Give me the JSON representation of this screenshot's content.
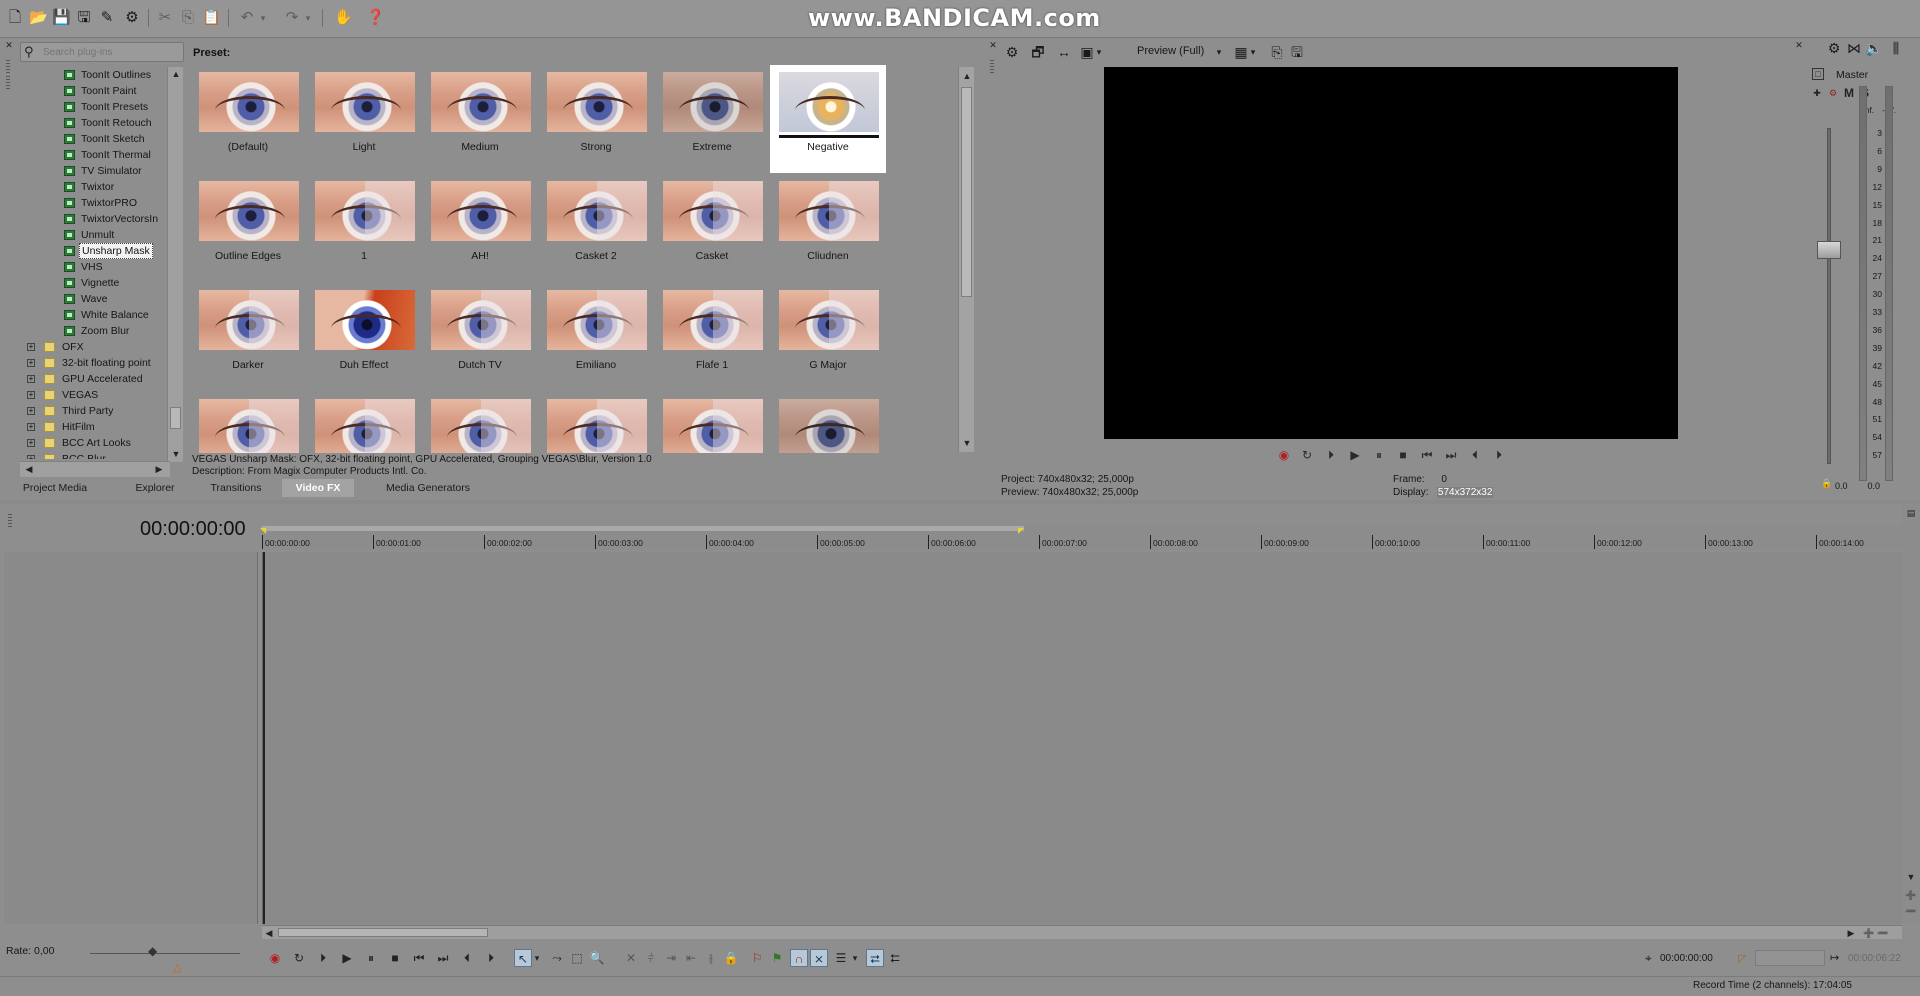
{
  "watermark": "www.BANDICAM.com",
  "search": {
    "placeholder": "Search plug-ins"
  },
  "tree": {
    "items": [
      {
        "label": "ToonIt Outlines",
        "type": "fx"
      },
      {
        "label": "ToonIt Paint",
        "type": "fx"
      },
      {
        "label": "ToonIt Presets",
        "type": "fx"
      },
      {
        "label": "ToonIt Retouch",
        "type": "fx"
      },
      {
        "label": "ToonIt Sketch",
        "type": "fx"
      },
      {
        "label": "ToonIt Thermal",
        "type": "fx"
      },
      {
        "label": "TV Simulator",
        "type": "fx"
      },
      {
        "label": "Twixtor",
        "type": "fx"
      },
      {
        "label": "TwixtorPRO",
        "type": "fx"
      },
      {
        "label": "TwixtorVectorsIn",
        "type": "fx"
      },
      {
        "label": "Unmult",
        "type": "fx"
      },
      {
        "label": "Unsharp Mask",
        "type": "fx",
        "selected": true
      },
      {
        "label": "VHS",
        "type": "fx"
      },
      {
        "label": "Vignette",
        "type": "fx"
      },
      {
        "label": "Wave",
        "type": "fx"
      },
      {
        "label": "White Balance",
        "type": "fx"
      },
      {
        "label": "Zoom Blur",
        "type": "fx"
      },
      {
        "label": "OFX",
        "type": "folder"
      },
      {
        "label": "32-bit floating point",
        "type": "folder"
      },
      {
        "label": "GPU Accelerated",
        "type": "folder"
      },
      {
        "label": "VEGAS",
        "type": "folder"
      },
      {
        "label": "Third Party",
        "type": "folder"
      },
      {
        "label": "HitFilm",
        "type": "folder"
      },
      {
        "label": "BCC Art Looks",
        "type": "folder"
      },
      {
        "label": "BCC Blur",
        "type": "folder"
      }
    ]
  },
  "preset_label": "Preset:",
  "presets": [
    {
      "name": "(Default)",
      "style": ""
    },
    {
      "name": "Light",
      "style": ""
    },
    {
      "name": "Medium",
      "style": ""
    },
    {
      "name": "Strong",
      "style": ""
    },
    {
      "name": "Extreme",
      "style": "dark"
    },
    {
      "name": "Negative",
      "style": "neg",
      "selected": true
    },
    {
      "name": "Outline Edges",
      "style": ""
    },
    {
      "name": "1",
      "style": "split"
    },
    {
      "name": "AH!",
      "style": ""
    },
    {
      "name": "Casket 2",
      "style": "split"
    },
    {
      "name": "Casket",
      "style": "split"
    },
    {
      "name": "Cliudnen",
      "style": "split"
    },
    {
      "name": "Darker",
      "style": "split"
    },
    {
      "name": "Duh Effect",
      "style": "red"
    },
    {
      "name": "Dutch TV",
      "style": "split"
    },
    {
      "name": "Emiliano",
      "style": "split"
    },
    {
      "name": "Flafe 1",
      "style": "split"
    },
    {
      "name": "G Major",
      "style": "split"
    },
    {
      "name": "",
      "style": "split"
    },
    {
      "name": "",
      "style": "split"
    },
    {
      "name": "",
      "style": "split"
    },
    {
      "name": "",
      "style": "split"
    },
    {
      "name": "",
      "style": "split"
    },
    {
      "name": "",
      "style": "dark"
    }
  ],
  "description": {
    "line1": "VEGAS Unsharp Mask: OFX, 32-bit floating point, GPU Accelerated, Grouping VEGAS\\Blur, Version 1.0",
    "line2": "Description: From Magix Computer Products Intl. Co."
  },
  "tabs": [
    "Project Media",
    "Explorer",
    "Transitions",
    "Video FX",
    "Media Generators"
  ],
  "active_tab": "Video FX",
  "preview": {
    "mode": "Preview (Full)",
    "project": "Project:  740x480x32; 25,000p",
    "preview": "Preview:  740x480x32; 25,000p",
    "frame_label": "Frame:",
    "frame_value": "0",
    "display_label": "Display:",
    "display_value": "574x372x32"
  },
  "master": {
    "title": "Master",
    "m_label": "M",
    "s_label": "S",
    "inf_left": "-Inf.",
    "inf_right": "-Inf.",
    "scale": [
      "3",
      "6",
      "9",
      "12",
      "15",
      "18",
      "21",
      "24",
      "27",
      "30",
      "33",
      "36",
      "39",
      "42",
      "45",
      "48",
      "51",
      "54",
      "57"
    ],
    "bottom_left": "0.0",
    "bottom_right": "0.0"
  },
  "timeline": {
    "timecode": "00:00:00:00",
    "ruler": [
      "00:00:00:00",
      "00:00:01:00",
      "00:00:02:00",
      "00:00:03:00",
      "00:00:04:00",
      "00:00:05:00",
      "00:00:06:00",
      "00:00:07:00",
      "00:00:08:00",
      "00:00:09:00",
      "00:00:10:00",
      "00:00:11:00",
      "00:00:12:00",
      "00:00:13:00",
      "00:00:14:00"
    ],
    "rate": "Rate: 0,00",
    "cursor_time": "00:00:00:00",
    "end_time": "00:00:06:22",
    "record_time": "Record Time (2 channels): 17:04:05"
  }
}
